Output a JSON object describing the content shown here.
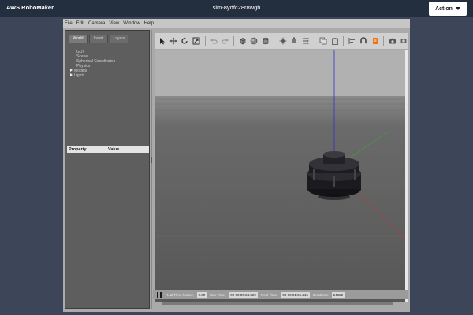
{
  "header": {
    "app_title": "AWS RoboMaker",
    "sim_id": "sim-8ydfc28r8wgh",
    "action_label": "Action"
  },
  "gazebo": {
    "menu": [
      "File",
      "Edit",
      "Camera",
      "View",
      "Window",
      "Help"
    ],
    "tabs": [
      "World",
      "Insert",
      "Layers"
    ],
    "tree": [
      {
        "label": "GUI",
        "expandable": false
      },
      {
        "label": "Scene",
        "expandable": false
      },
      {
        "label": "Spherical Coordinates",
        "expandable": false
      },
      {
        "label": "Physics",
        "expandable": false
      },
      {
        "label": "Models",
        "expandable": true
      },
      {
        "label": "Lights",
        "expandable": true
      }
    ],
    "property_header": {
      "property": "Property",
      "value": "Value"
    },
    "toolbar_icons": [
      "select-arrow-icon",
      "translate-icon",
      "rotate-icon",
      "scale-icon",
      "undo-icon",
      "redo-icon",
      "box-icon",
      "sphere-icon",
      "cylinder-icon",
      "point-light-icon",
      "spot-light-icon",
      "directional-light-icon",
      "copy-icon",
      "paste-icon",
      "align-icon",
      "snap-icon",
      "change-view-icon",
      "screenshot-icon",
      "record-icon"
    ],
    "timebar": {
      "real_time_factor_label": "Real Time Factor:",
      "real_time_factor_value": "0.00",
      "sim_time_label": "Sim Time:",
      "sim_time_value": "00 00:00:24.822",
      "real_time_label": "Real Time:",
      "real_time_value": "00 00:01:31.216",
      "iterations_label": "Iterations:",
      "iterations_value": "24822"
    },
    "colors": {
      "sky": "#b1b1b1",
      "ground": "#5a5a5a",
      "axis_x": "#c83232",
      "axis_y": "#32b432",
      "axis_z": "#3232c8",
      "robot": "#1b1b1f"
    }
  }
}
